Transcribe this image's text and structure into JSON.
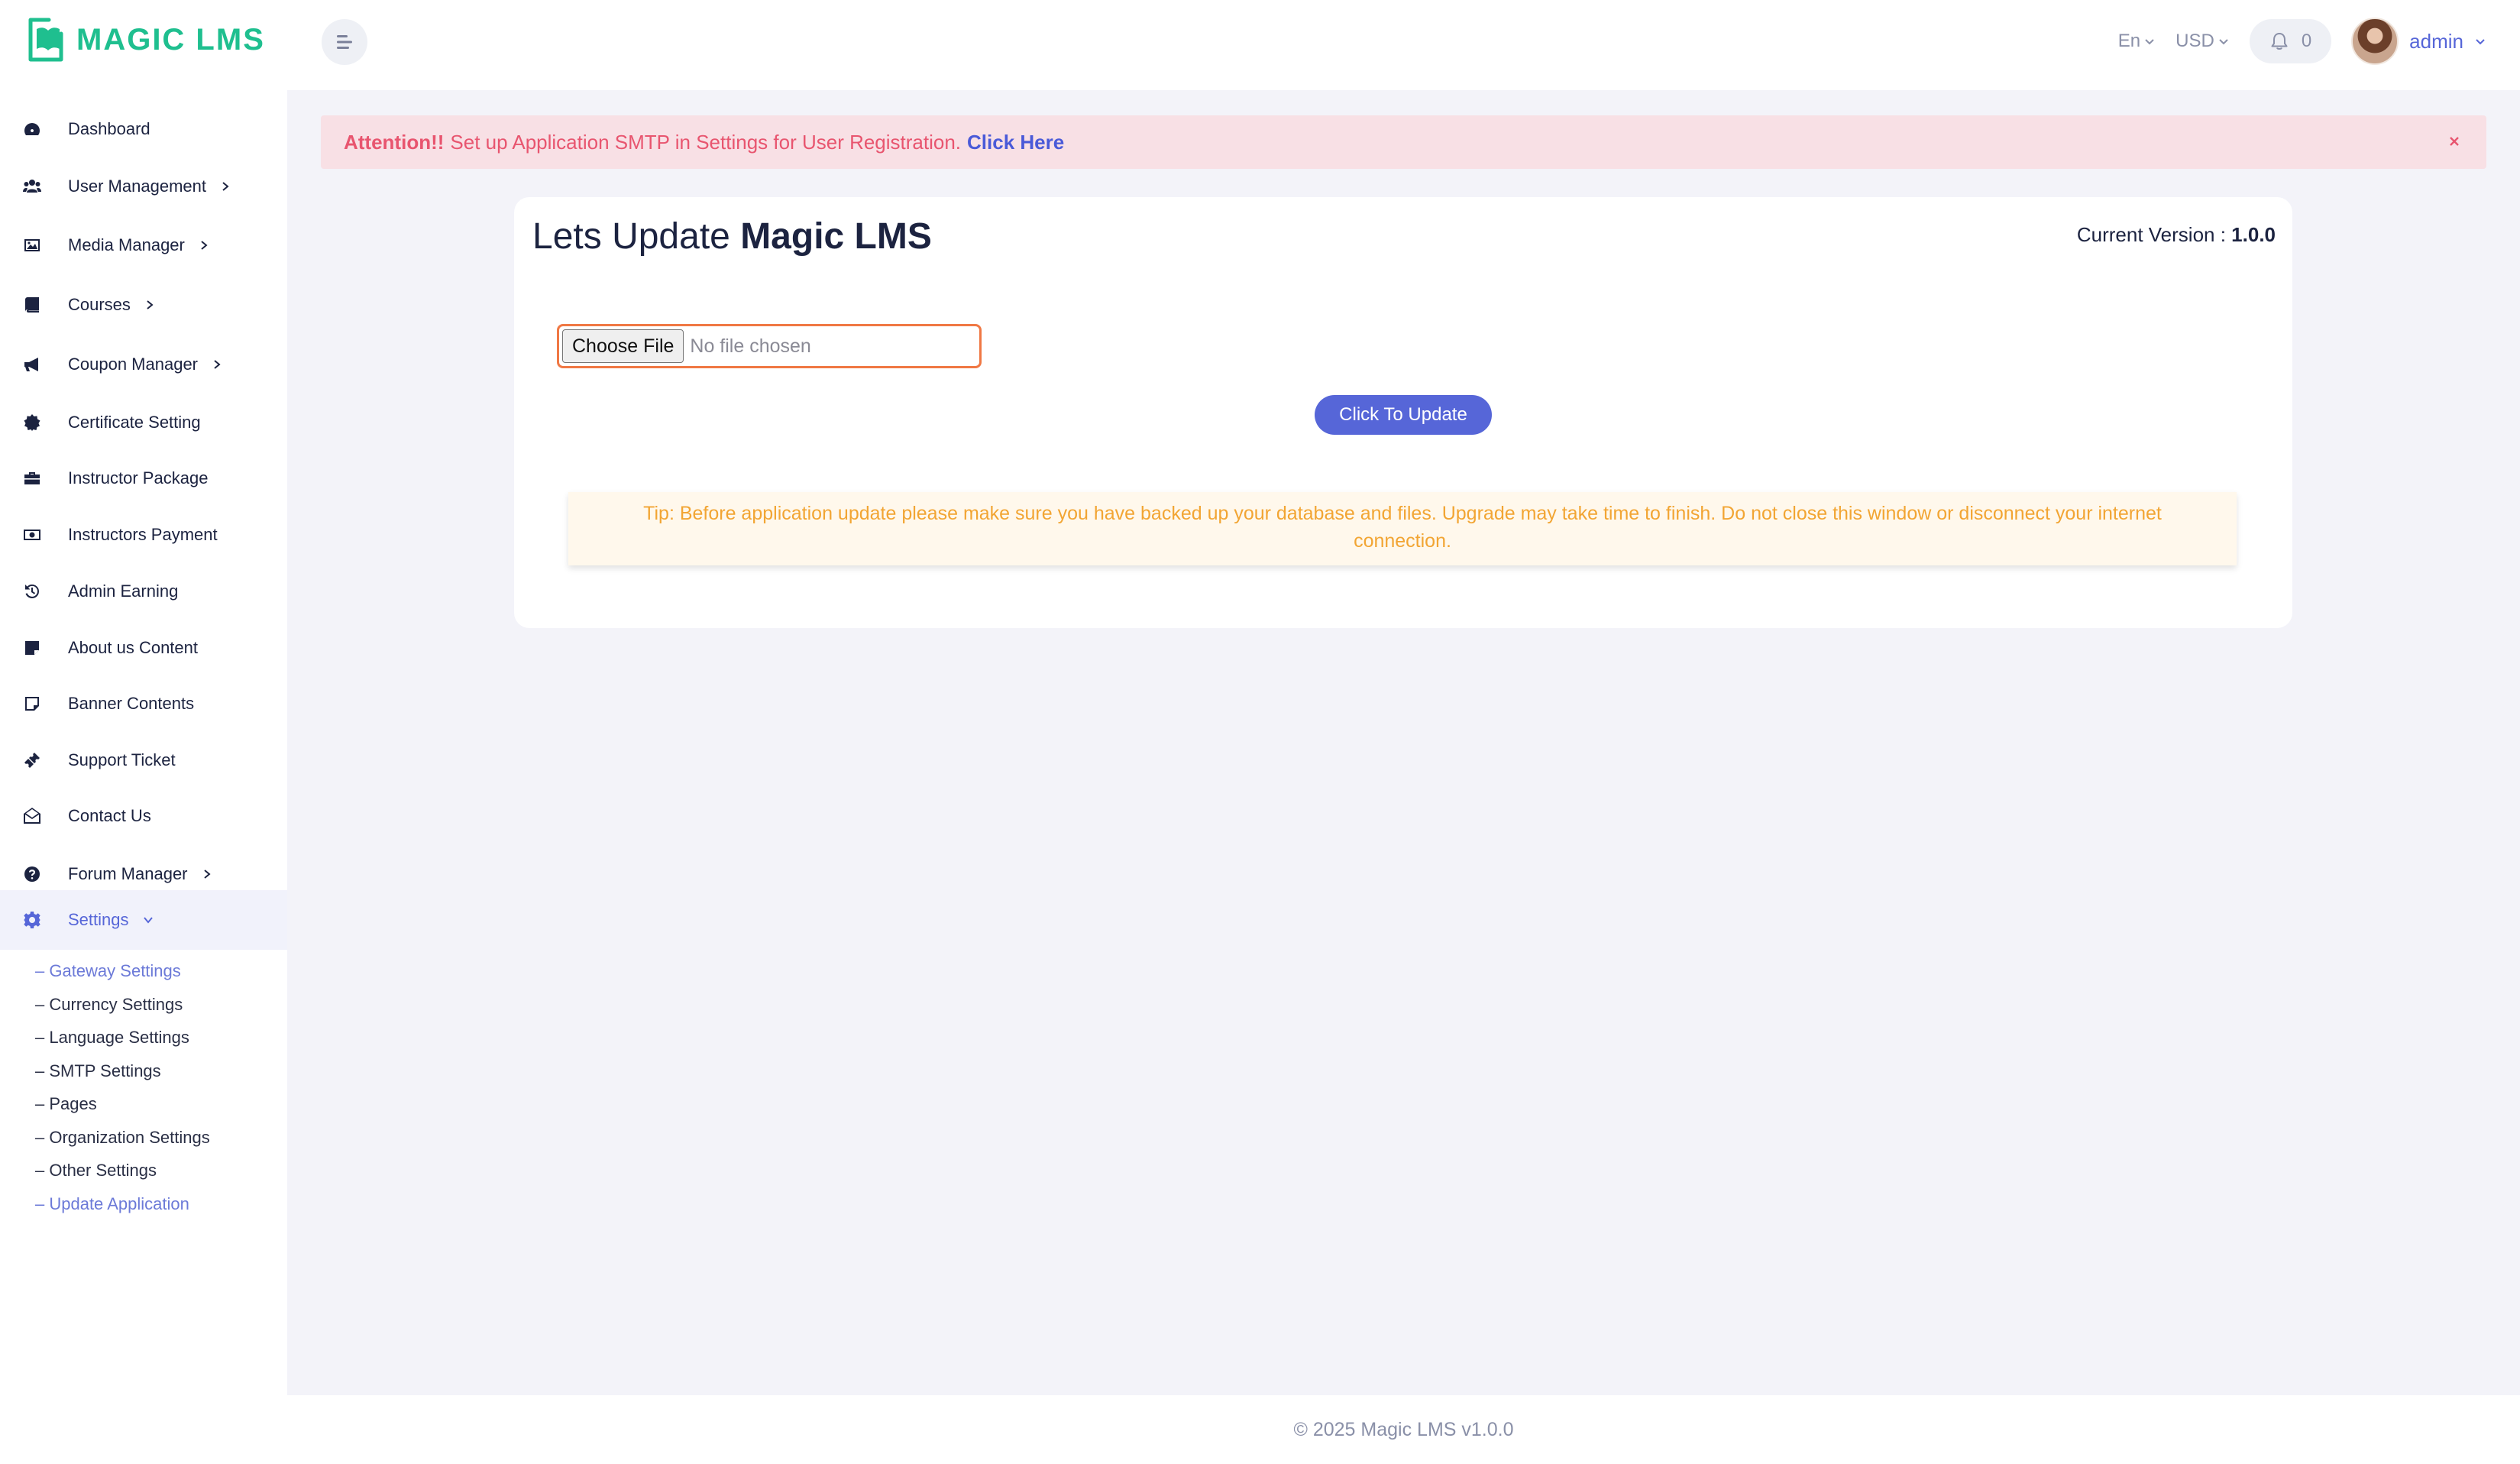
{
  "brand": {
    "name": "MAGIC LMS",
    "accent": "#1fbf8f",
    "primary": "#5666d8"
  },
  "header": {
    "language": "En",
    "currency": "USD",
    "notification_count": "0",
    "user_name": "admin"
  },
  "sidebar": {
    "items": [
      {
        "label": "Dashboard",
        "icon": "dashboard-icon"
      },
      {
        "label": "User Management",
        "icon": "users-icon"
      },
      {
        "label": "Media Manager",
        "icon": "image-icon"
      },
      {
        "label": "Courses",
        "icon": "book-icon"
      },
      {
        "label": "Coupon Manager",
        "icon": "megaphone-icon"
      },
      {
        "label": "Certificate Setting",
        "icon": "certificate-icon"
      },
      {
        "label": "Instructor Package",
        "icon": "briefcase-icon"
      },
      {
        "label": "Instructors Payment",
        "icon": "money-icon"
      },
      {
        "label": "Admin Earning",
        "icon": "history-icon"
      },
      {
        "label": "About us Content",
        "icon": "note-icon"
      },
      {
        "label": "Banner Contents",
        "icon": "sticky-note-icon"
      },
      {
        "label": "Support Ticket",
        "icon": "ticket-icon"
      },
      {
        "label": "Contact Us",
        "icon": "envelope-open-icon"
      },
      {
        "label": "Forum Manager",
        "icon": "question-icon"
      },
      {
        "label": "Settings",
        "icon": "gear-icon"
      }
    ],
    "settings_sub": [
      "– Gateway Settings",
      "– Currency Settings",
      "– Language Settings",
      "– SMTP Settings",
      "– Pages",
      "– Organization Settings",
      "– Other Settings",
      "– Update Application"
    ]
  },
  "alert": {
    "strong": "Attention!!",
    "message": "Set up Application SMTP in Settings for User Registration.",
    "link": "Click Here"
  },
  "card": {
    "title_prefix": "Lets Update",
    "title_strong": "Magic LMS",
    "version_label": "Current Version :",
    "version_value": "1.0.0",
    "file_button": "Choose File",
    "file_status": "No file chosen",
    "update_button": "Click To Update",
    "tip": "Tip: Before application update please make sure you have backed up your database and files. Upgrade may take time to finish. Do not close this window or disconnect your internet connection."
  },
  "footer": {
    "text": "© 2025 Magic LMS v1.0.0"
  }
}
